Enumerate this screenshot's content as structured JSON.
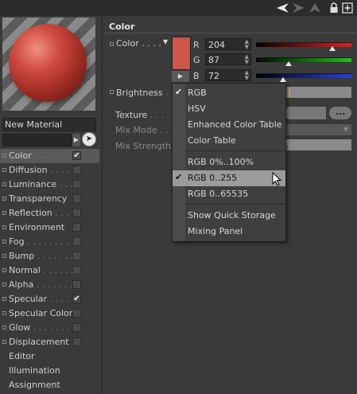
{
  "toolbar": {
    "icons": [
      "back-arrow-icon",
      "forward-arrow-icon",
      "up-arrow-icon",
      "lock-icon",
      "new-panel-icon"
    ]
  },
  "material": {
    "name": "New Material",
    "search_placeholder": ""
  },
  "channels": [
    {
      "label": "Color",
      "dots": " . . . . . .",
      "checked": true,
      "has_checkbox": true,
      "selected": true
    },
    {
      "label": "Diffusion",
      "dots": " . . . . .",
      "checked": false,
      "has_checkbox": true
    },
    {
      "label": "Luminance",
      "dots": " . . . .",
      "checked": false,
      "has_checkbox": true
    },
    {
      "label": "Transparency",
      "dots": "",
      "checked": false,
      "has_checkbox": true
    },
    {
      "label": "Reflection",
      "dots": " . . . .",
      "checked": false,
      "has_checkbox": true
    },
    {
      "label": "Environment",
      "dots": "",
      "checked": false,
      "has_checkbox": true
    },
    {
      "label": "Fog",
      "dots": " . . . . . . . .",
      "checked": false,
      "has_checkbox": true
    },
    {
      "label": "Bump",
      "dots": " . . . . . . .",
      "checked": false,
      "has_checkbox": true
    },
    {
      "label": "Normal",
      "dots": " . . . . . .",
      "checked": false,
      "has_checkbox": true
    },
    {
      "label": "Alpha",
      "dots": " . . . . . . .",
      "checked": false,
      "has_checkbox": true
    },
    {
      "label": "Specular",
      "dots": " . . . . .",
      "checked": true,
      "has_checkbox": true
    },
    {
      "label": "Specular Color",
      "dots": "",
      "checked": false,
      "has_checkbox": true
    },
    {
      "label": "Glow",
      "dots": " . . . . . . . .",
      "checked": false,
      "has_checkbox": true
    },
    {
      "label": "Displacement",
      "dots": "",
      "checked": false,
      "has_checkbox": true
    },
    {
      "label": "Editor",
      "dots": "",
      "checked": false,
      "has_checkbox": false
    },
    {
      "label": "Illumination",
      "dots": "",
      "checked": false,
      "has_checkbox": false
    },
    {
      "label": "Assignment",
      "dots": "",
      "checked": false,
      "has_checkbox": false
    }
  ],
  "section": {
    "title": "Color"
  },
  "params": {
    "color_label": "Color . . . .",
    "brightness_label": "Brightness",
    "brightness_dots": " . .",
    "texture_label": "Texture",
    "texture_dots": " . . .",
    "texture_button": "...",
    "mix_mode_label": "Mix Mode",
    "mix_mode_dots": " . . .",
    "mix_strength_label": "Mix Strength"
  },
  "color": {
    "swatch_hex": "#cc5748",
    "r_label": "R",
    "r_value": "204",
    "r_fraction": 0.8,
    "g_label": "G",
    "g_value": "87",
    "g_fraction": 0.341,
    "b_label": "B",
    "b_value": "72",
    "b_fraction": 0.282
  },
  "menu": {
    "items": [
      {
        "label": "RGB",
        "checked": true
      },
      {
        "label": "HSV",
        "checked": false
      },
      {
        "label": "Enhanced Color Table",
        "checked": false
      },
      {
        "label": "Color Table",
        "checked": false
      },
      {
        "label": "RGB 0%..100%",
        "checked": false
      },
      {
        "label": "RGB 0..255",
        "checked": true,
        "highlighted": true
      },
      {
        "label": "RGB 0..65535",
        "checked": false
      },
      {
        "label": "Show Quick Storage",
        "checked": false
      },
      {
        "label": "Mixing Panel",
        "checked": false
      }
    ]
  },
  "colors": {
    "red_slider": "#e02020",
    "green_slider": "#1fbf1f",
    "blue_slider": "#2a3fe0"
  }
}
